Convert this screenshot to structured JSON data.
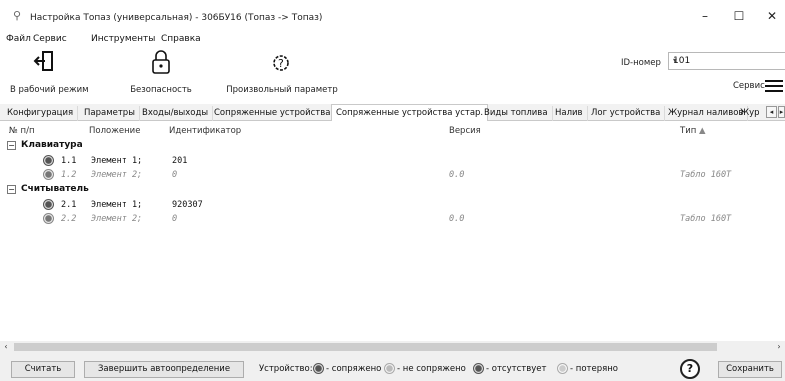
{
  "window": {
    "title": "Настройка Топаз (универсальная) - 306БУ16 (Топаз -> Топаз)",
    "minimize": "–",
    "maximize": "☐",
    "close": "✕"
  },
  "menu": [
    "Файл",
    "Сервис",
    "Инструменты",
    "Справка"
  ],
  "toolbar": {
    "work_mode": "В рабочий режим",
    "security": "Безопасность",
    "custom_param": "Произвольный параметр",
    "id_label": "ID-номер",
    "id_value": "101",
    "service": "Сервис"
  },
  "tabs": [
    "Конфигурация",
    "Параметры",
    "Входы/выходы",
    "Сопряженные устройства",
    "Сопряженные устройства устар.",
    "Виды топлива",
    "Налив",
    "Лог устройства",
    "Журнал наливов",
    "Жур"
  ],
  "active_tab": 4,
  "columns": {
    "num": "№ п/п",
    "position": "Положение",
    "identifier": "Идентификатор",
    "version": "Версия",
    "type": "Тип"
  },
  "groups": [
    {
      "name": "Клавиатура",
      "toggle": "⊟",
      "rows": [
        {
          "num": "1.1",
          "position": "Элемент 1;",
          "identifier": "201",
          "version": "",
          "type": "",
          "dim": false
        },
        {
          "num": "1.2",
          "position": "Элемент 2;",
          "identifier": "0",
          "version": "0.0",
          "type": "Табло 160Т",
          "dim": true
        }
      ]
    },
    {
      "name": "Считыватель",
      "toggle": "⊟",
      "rows": [
        {
          "num": "2.1",
          "position": "Элемент 1;",
          "identifier": "920307",
          "version": "",
          "type": "",
          "dim": false
        },
        {
          "num": "2.2",
          "position": "Элемент 2;",
          "identifier": "0",
          "version": "0.0",
          "type": "Табло 160Т",
          "dim": true
        }
      ]
    }
  ],
  "status": {
    "read": "Считать",
    "finish_auto": "Завершить автоопределение",
    "device": "Устройство:",
    "paired": "- сопряжено",
    "not_paired": "- не сопряжено",
    "absent": "- отсутствует",
    "lost": "- потеряно",
    "help": "?",
    "save": "Сохранить"
  },
  "colors": {
    "led_active": "#555555",
    "led_inactive": "#d8d8d8",
    "tab_bg": "#f2f2f2",
    "status_bg": "#f0f0f0"
  }
}
